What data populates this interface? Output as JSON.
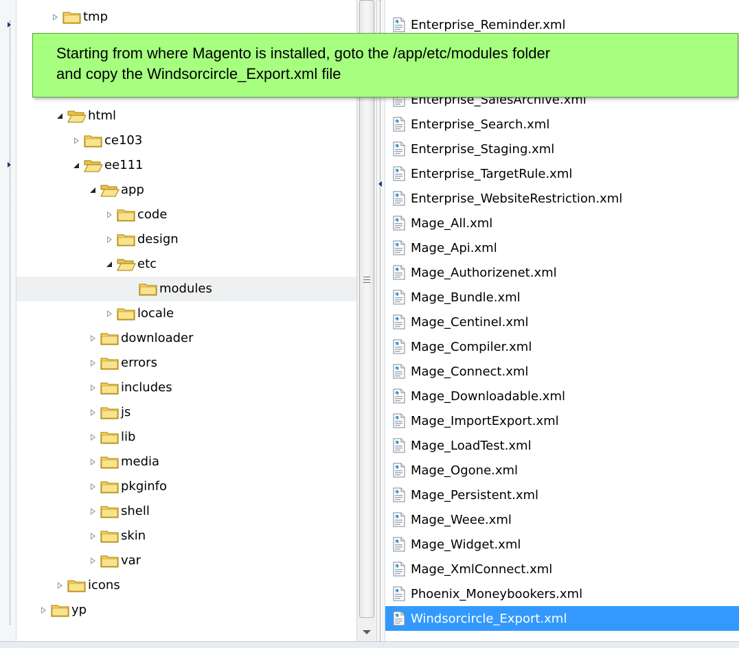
{
  "tree": {
    "items": [
      {
        "label": "tmp",
        "state": "collapsed"
      },
      {
        "label": "html",
        "state": "expanded"
      },
      {
        "label": "ce103",
        "state": "collapsed"
      },
      {
        "label": "ee111",
        "state": "expanded"
      },
      {
        "label": "app",
        "state": "expanded"
      },
      {
        "label": "code",
        "state": "collapsed"
      },
      {
        "label": "design",
        "state": "collapsed"
      },
      {
        "label": "etc",
        "state": "expanded"
      },
      {
        "label": "modules",
        "state": "none",
        "selected": true
      },
      {
        "label": "locale",
        "state": "collapsed"
      },
      {
        "label": "downloader",
        "state": "collapsed"
      },
      {
        "label": "errors",
        "state": "collapsed"
      },
      {
        "label": "includes",
        "state": "collapsed"
      },
      {
        "label": "js",
        "state": "collapsed"
      },
      {
        "label": "lib",
        "state": "collapsed"
      },
      {
        "label": "media",
        "state": "collapsed"
      },
      {
        "label": "pkginfo",
        "state": "collapsed"
      },
      {
        "label": "shell",
        "state": "collapsed"
      },
      {
        "label": "skin",
        "state": "collapsed"
      },
      {
        "label": "var",
        "state": "collapsed"
      },
      {
        "label": "icons",
        "state": "collapsed"
      },
      {
        "label": "yp",
        "state": "collapsed"
      }
    ]
  },
  "files": {
    "items": [
      {
        "label": "Enterprise_Reminder.xml"
      },
      {
        "label": "Enterprise_SalesArchive.xml"
      },
      {
        "label": "Enterprise_Search.xml"
      },
      {
        "label": "Enterprise_Staging.xml"
      },
      {
        "label": "Enterprise_TargetRule.xml"
      },
      {
        "label": "Enterprise_WebsiteRestriction.xml"
      },
      {
        "label": "Mage_All.xml"
      },
      {
        "label": "Mage_Api.xml"
      },
      {
        "label": "Mage_Authorizenet.xml"
      },
      {
        "label": "Mage_Bundle.xml"
      },
      {
        "label": "Mage_Centinel.xml"
      },
      {
        "label": "Mage_Compiler.xml"
      },
      {
        "label": "Mage_Connect.xml"
      },
      {
        "label": "Mage_Downloadable.xml"
      },
      {
        "label": "Mage_ImportExport.xml"
      },
      {
        "label": "Mage_LoadTest.xml"
      },
      {
        "label": "Mage_Ogone.xml"
      },
      {
        "label": "Mage_Persistent.xml"
      },
      {
        "label": "Mage_Weee.xml"
      },
      {
        "label": "Mage_Widget.xml"
      },
      {
        "label": "Mage_XmlConnect.xml"
      },
      {
        "label": "Phoenix_Moneybookers.xml"
      },
      {
        "label": "Windsorcircle_Export.xml",
        "selected": true
      }
    ]
  },
  "callout": {
    "line1": "Starting from where Magento is installed, goto the /app/etc/modules folder",
    "line2": "and copy the Windsorcircle_Export.xml file"
  },
  "colors": {
    "callout_bg": "#a6ff7f",
    "selection": "#3399ff",
    "folder": "#f5d36a"
  }
}
